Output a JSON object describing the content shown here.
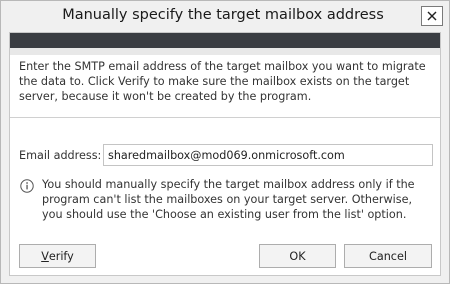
{
  "dialog": {
    "title": "Manually specify the target mailbox address",
    "intro_text": "Enter the SMTP email address of the target mailbox you want to migrate the data to. Click Verify to make sure the mailbox exists on the target server, because it won't be created by the program.",
    "email_label": "Email address:",
    "email_value": "sharedmailbox@mod069.onmicrosoft.com",
    "info_text": "You should manually specify the target mailbox address only if the program can't list the mailboxes on your target server. Otherwise, you should use the 'Choose an existing user from the list' option."
  },
  "buttons": {
    "verify_first": "V",
    "verify_rest": "erify",
    "ok": "OK",
    "cancel": "Cancel"
  },
  "icons": {
    "close": "close-icon",
    "info": "info-icon"
  },
  "colors": {
    "header_bar": "#3a3d42",
    "window_bg": "#f0f0f0"
  }
}
